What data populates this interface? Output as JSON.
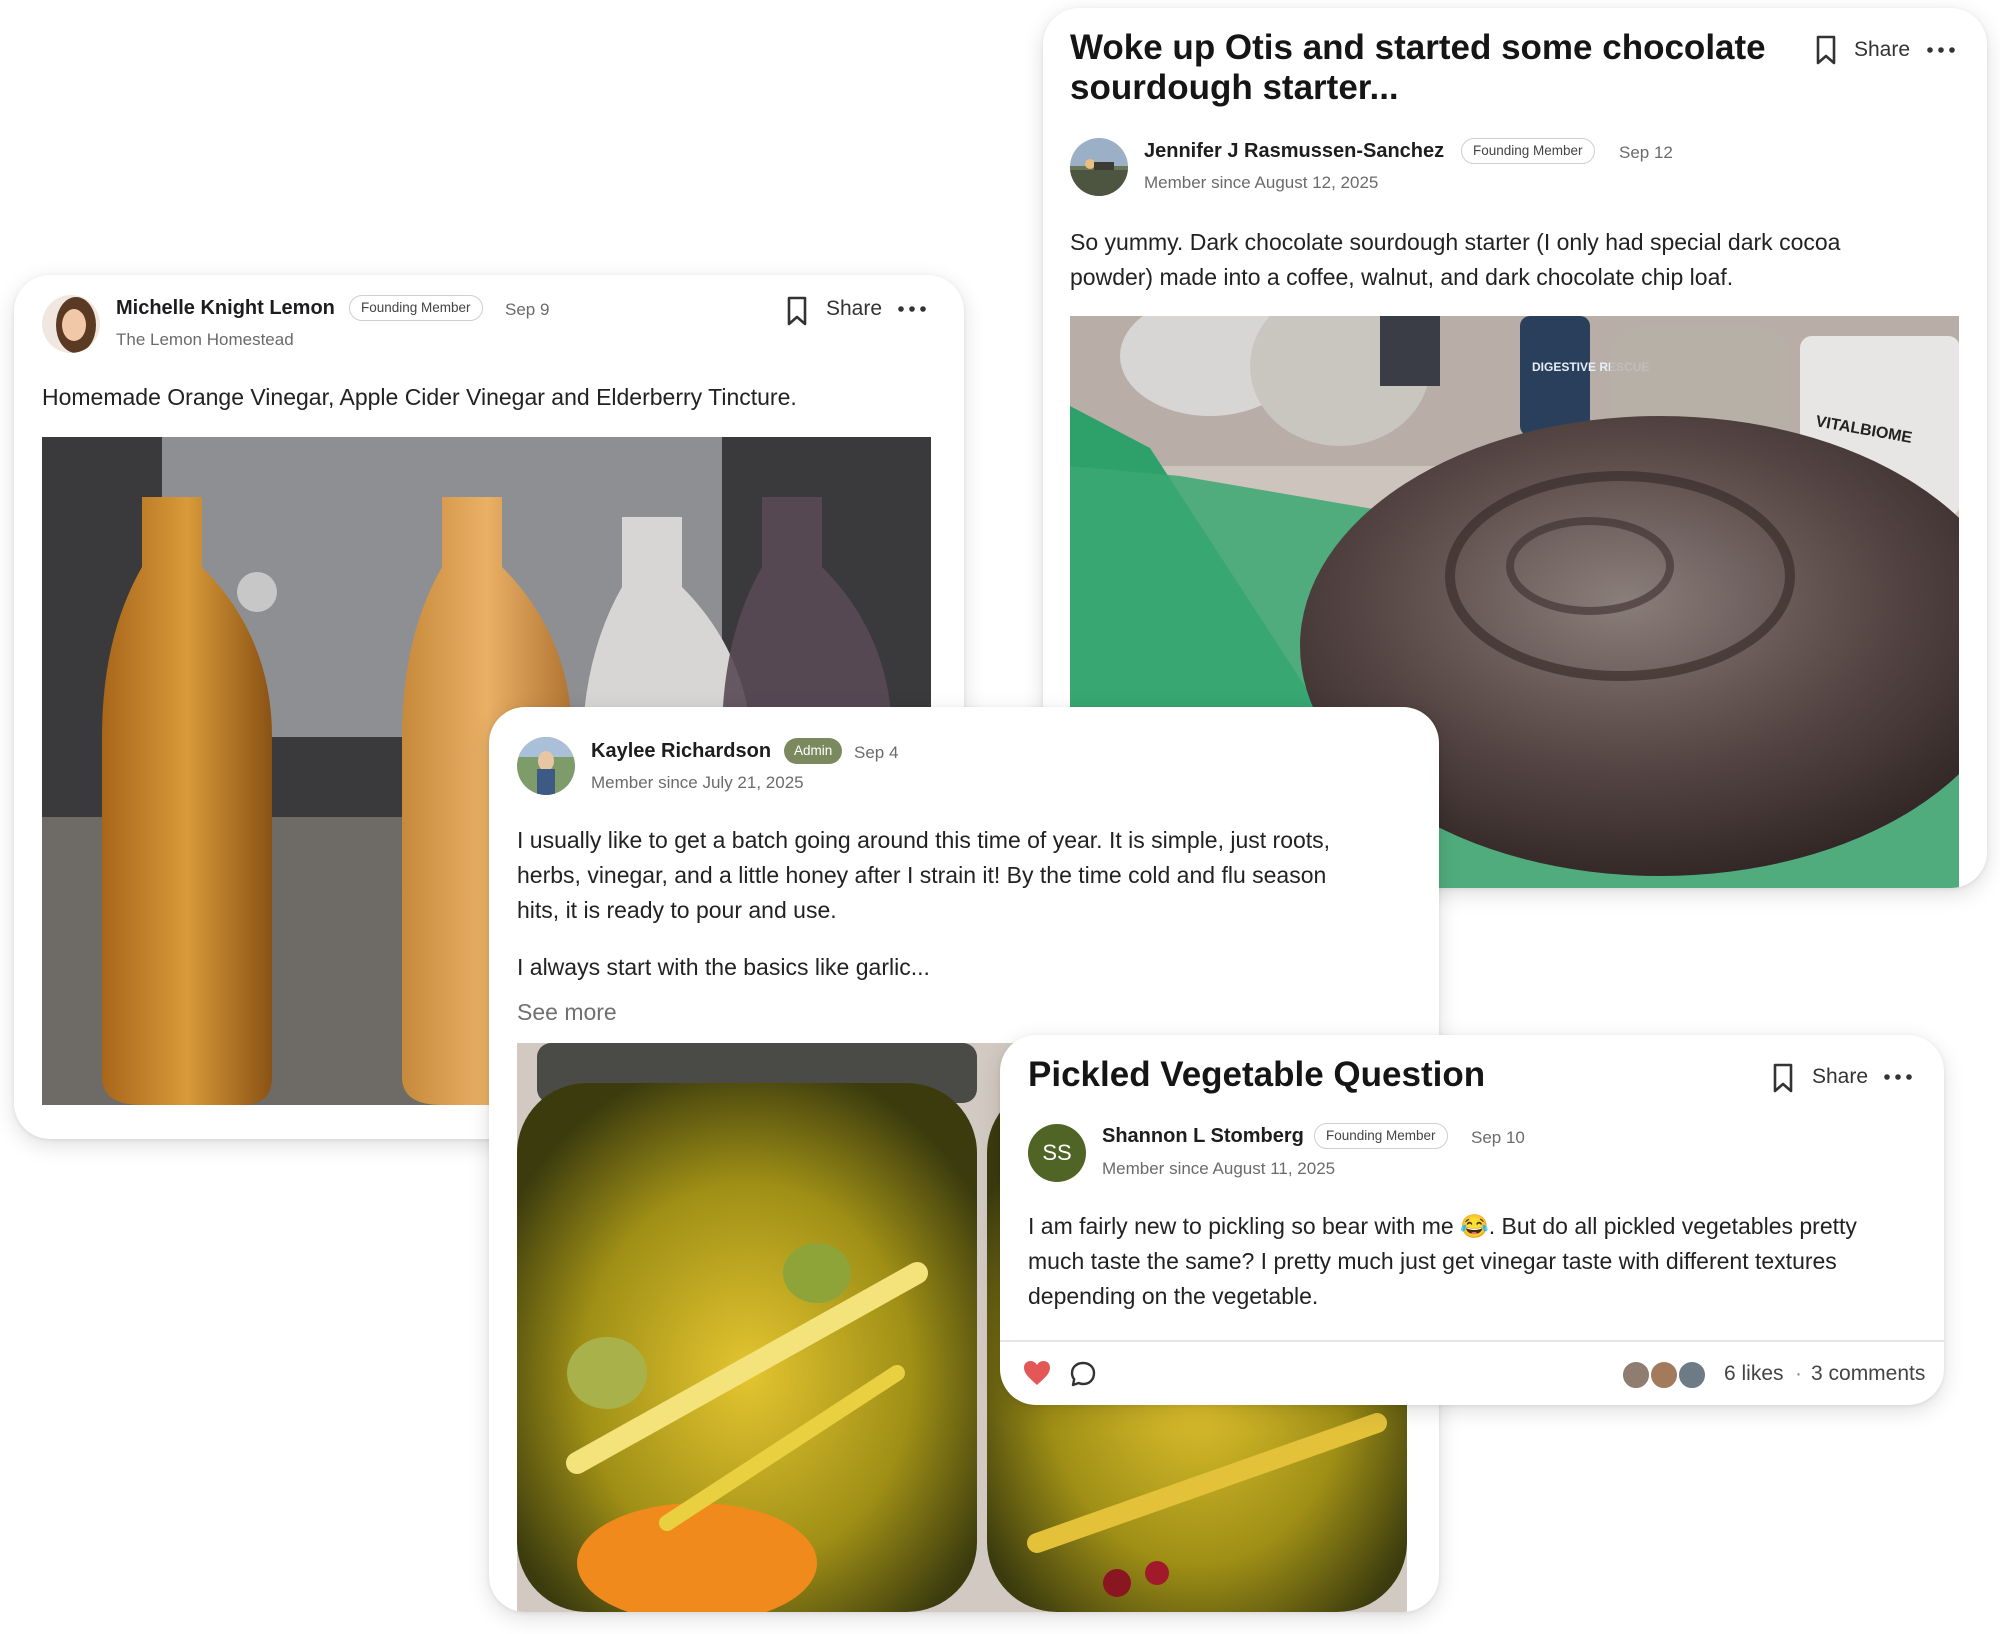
{
  "post_jennifer": {
    "title_line1": "Woke up Otis and started some chocolate",
    "title_line2": "sourdough starter...",
    "author": "Jennifer J Rasmussen-Sanchez",
    "badge": "Founding Member",
    "date": "Sep 12",
    "member_since": "Member since August 12, 2025",
    "body_line1": "So yummy.  Dark chocolate sourdough starter (I only had special dark cocoa",
    "body_line2": "powder) made into a coffee, walnut, and dark chocolate chip loaf.",
    "share_label": "Share",
    "photo_label_bottle": "DIGESTIVE RESCUE",
    "photo_label_jar": "VITALBIOME"
  },
  "post_michelle": {
    "author": "Michelle Knight Lemon",
    "badge": "Founding Member",
    "date": "Sep 9",
    "subtitle": "The Lemon Homestead",
    "body": "Homemade Orange Vinegar, Apple Cider Vinegar and Elderberry Tincture.",
    "share_label": "Share"
  },
  "post_kaylee": {
    "author": "Kaylee Richardson",
    "badge": "Admin",
    "date": "Sep 4",
    "member_since": "Member since July 21, 2025",
    "body_line1": "I usually like to get a batch going around this time of year. It is simple, just roots,",
    "body_line2": "herbs, vinegar, and a little honey after I strain it! By the time cold and flu season",
    "body_line3": "hits, it is ready to pour and use.",
    "body_line4": "I always start with the basics like garlic...",
    "see_more": "See more"
  },
  "post_shannon": {
    "title": "Pickled Vegetable Question",
    "author": "Shannon L Stomberg",
    "initials": "SS",
    "badge": "Founding Member",
    "date": "Sep 10",
    "member_since": "Member since August 11, 2025",
    "body_line1": "I am fairly new to pickling so bear with me 😂.  But do all pickled vegetables pretty",
    "body_line2": "much taste the same?  I pretty much just get vinegar taste with different textures",
    "body_line3": "depending on the vegetable.",
    "share_label": "Share",
    "likes": "6 likes",
    "separator": "·",
    "comments": "3 comments"
  },
  "icons": {
    "bookmark": "bookmark-icon",
    "more": "more-dots-icon",
    "heart": "heart-icon",
    "comment": "comment-bubble-icon"
  },
  "colors": {
    "admin_badge": "#7a8a5e",
    "initials_avatar": "#4f6425",
    "like_heart": "#e45757"
  }
}
